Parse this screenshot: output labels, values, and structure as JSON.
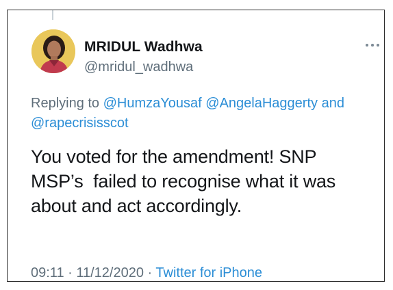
{
  "tweet": {
    "author": {
      "display_name": "MRIDUL Wadhwa",
      "handle": "@mridul_wadhwa"
    },
    "more_icon": "more-horizontal-icon",
    "replying_to": {
      "prefix": "Replying to",
      "mentions": [
        "@HumzaYousaf",
        "@AngelaHaggerty",
        "and",
        "@rapecrisisscot"
      ]
    },
    "text_lines": [
      "You voted for the amendment! SNP",
      "MSP’s  failed to recognise what it was",
      "about and act accordingly."
    ],
    "timestamp": "09:11 · 11/12/2020",
    "separator": "·",
    "source": "Twitter for iPhone"
  },
  "colors": {
    "link": "#2c8ed6",
    "secondary_text": "#5f6e7a",
    "primary_text": "#141619",
    "border": "#2b2b2b"
  }
}
